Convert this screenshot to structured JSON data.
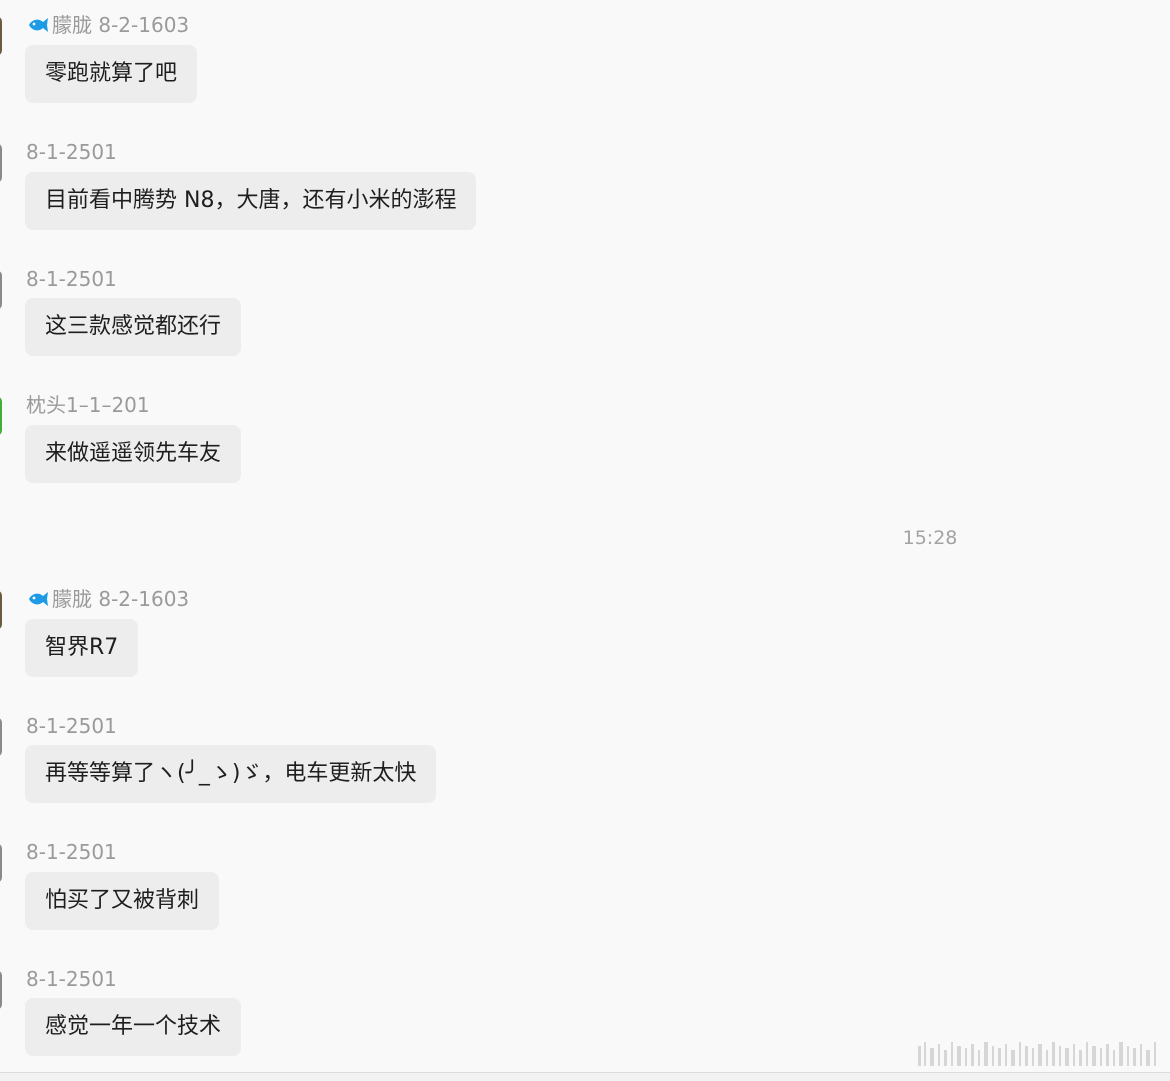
{
  "chat": {
    "messages": [
      {
        "sender": "朦胧 8-2-1603",
        "text": "零跑就算了吧",
        "sender_icon": "fish-icon",
        "avatar_color": "#6b5c3e"
      },
      {
        "sender": "8-1-2501",
        "text": "目前看中腾势 N8，大唐，还有小米的澎程",
        "sender_icon": "",
        "avatar_color": "#8a8a8a"
      },
      {
        "sender": "8-1-2501",
        "text": "这三款感觉都还行",
        "sender_icon": "",
        "avatar_color": "#8a8a8a"
      },
      {
        "sender": "枕头1–1–201",
        "text": "来做遥遥领先车友",
        "sender_icon": "",
        "avatar_color": "#3fae3a"
      },
      {
        "sender": "朦胧 8-2-1603",
        "text": "智界R7",
        "sender_icon": "fish-icon",
        "avatar_color": "#6b5c3e"
      },
      {
        "sender": "8-1-2501",
        "text": "再等等算了ヽ(╯_ゝ)ゞ，电车更新太快",
        "sender_icon": "",
        "avatar_color": "#8a8a8a"
      },
      {
        "sender": "8-1-2501",
        "text": "怕买了又被背刺",
        "sender_icon": "",
        "avatar_color": "#8a8a8a"
      },
      {
        "sender": "8-1-2501",
        "text": "感觉一年一个技术",
        "sender_icon": "",
        "avatar_color": "#8a8a8a"
      }
    ],
    "time_divider": "15:28"
  },
  "colors": {
    "background": "#f9f9f9",
    "bubble": "#ededed",
    "sender_text": "#9a9a9a",
    "fish_icon": "#1e9be6"
  }
}
